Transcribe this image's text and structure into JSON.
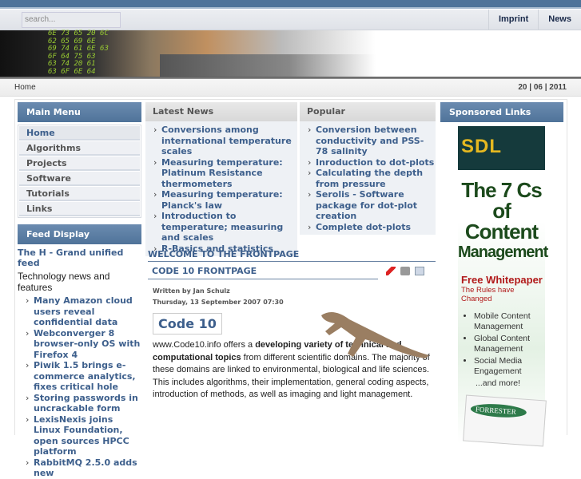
{
  "search": {
    "placeholder": "search..."
  },
  "nav": {
    "links": [
      "Imprint",
      "News"
    ]
  },
  "banner": {
    "hex": [
      "6E 73 65 20 6C",
      "62 65 69 6E",
      "69 74 61 6E 63",
      "6F 64 75 63",
      "63 74 20 61",
      "63 6F 6E 64"
    ]
  },
  "breadcrumb": {
    "home": "Home",
    "date": "20 | 06 | 2011"
  },
  "main_menu": {
    "title": "Main Menu",
    "items": [
      "Home",
      "Algorithms",
      "Projects",
      "Software",
      "Tutorials",
      "Links"
    ]
  },
  "feed": {
    "title": "Feed Display",
    "feed_name": "The H - Grand unified feed",
    "description": "Technology news and features",
    "items": [
      "Many Amazon cloud users reveal confidential data",
      "Webconverger 8 browser-only OS with Firefox 4",
      "Piwik 1.5 brings e-commerce analytics, fixes critical hole",
      "Storing passwords in uncrackable form",
      "LexisNexis joins Linux Foundation, open sources HPCC platform",
      "RabbitMQ 2.5.0 adds new"
    ]
  },
  "latest_news": {
    "title": "Latest News",
    "items": [
      "Conversions among international temperature scales",
      "Measuring temperature: Platinum Resistance thermometers",
      "Measuring temperature: Planck's law",
      "Introduction to temperature; measuring and scales",
      "R-Basics and statistics"
    ]
  },
  "popular": {
    "title": "Popular",
    "items": [
      "Conversion between conductivity and PSS-78 salinity",
      "Inroduction to dot-plots",
      "Calculating the depth from pressure",
      "Serolis - Software package for dot-plot creation",
      "Complete dot-plots"
    ]
  },
  "article": {
    "section": "WELCOME TO THE FRONTPAGE",
    "title": "CODE 10 FRONTPAGE",
    "author": "Written by Jan Schulz",
    "date": "Thursday, 13 September 2007 07:30",
    "logo": "Code 10",
    "intro": "www.Code10.info offers a ",
    "bold": "developing variety of technical and computational topics",
    "rest": " from different scientific domains. The majority of these domains are linked to environmental, biological and life sciences. This includes algorithms, their implementation, general coding aspects, introduction of methods, as well as imaging and light management."
  },
  "sponsored": {
    "title": "Sponsored Links",
    "ad": {
      "brand": "SDL",
      "line1": "The 7 Cs",
      "line2": "of Content",
      "line3": "Management",
      "cta": "Free Whitepaper",
      "sub": "The Rules have Changed",
      "bullets": [
        "Mobile Content Management",
        "Global Content Management",
        "Social Media Engagement"
      ],
      "more": "...and more!",
      "forrester": "FORRESTER"
    }
  }
}
